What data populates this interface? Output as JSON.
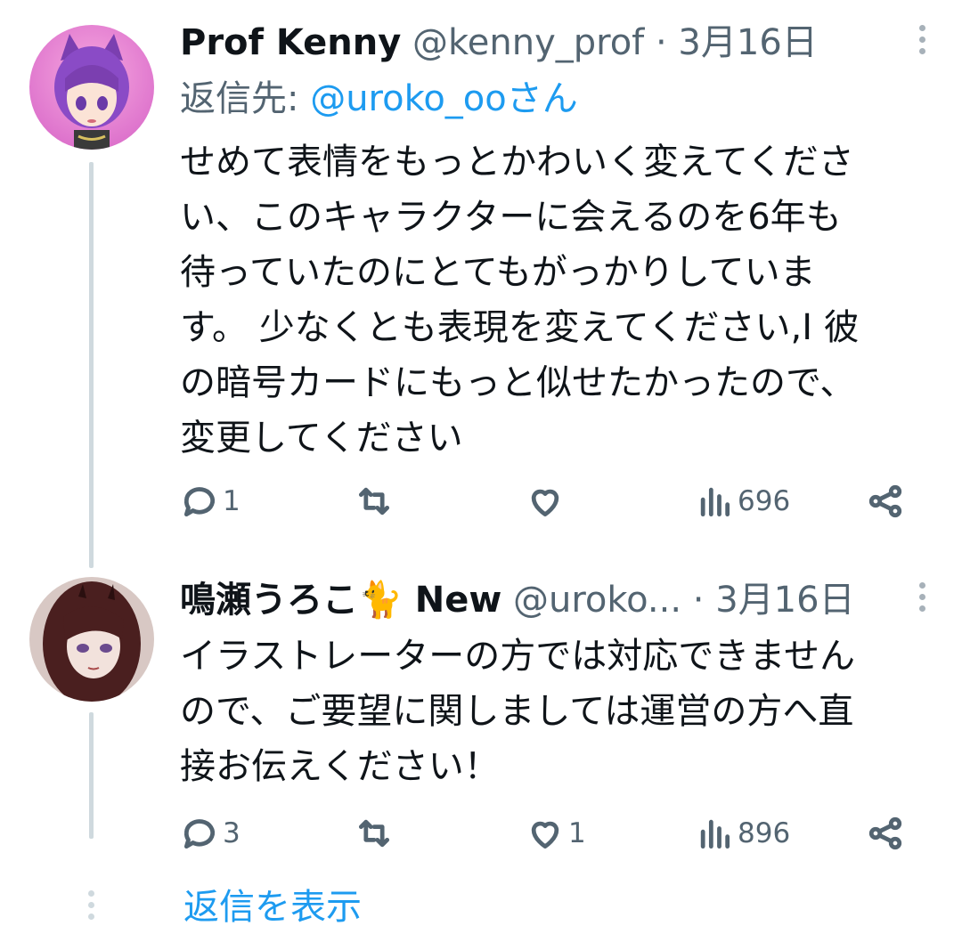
{
  "tweets": [
    {
      "name": "Prof Kenny",
      "handle": "@kenny_prof",
      "date": "3月16日",
      "reply_prefix": "返信先: ",
      "reply_mention": "@uroko_ooさん",
      "lines": [
        "せめて表情をもっとかわいく変えてくださ",
        "い、このキャラクターに会えるのを6年も",
        "待っていたのにとてもがっかりしていま",
        "す。 少なくとも表現を変えてください,I 彼",
        "の暗号カードにもっと似せたかったので、",
        "変更してください"
      ],
      "replies": "1",
      "retweets": "",
      "likes": "",
      "views": "696"
    },
    {
      "name": "鳴瀬うろこ🐈 New",
      "handle": "@uroko...",
      "date": "3月16日",
      "lines": [
        "イラストレーターの方では対応できません",
        "ので、ご要望に関しましては運営の方へ直",
        "接お伝えください！"
      ],
      "replies": "3",
      "retweets": "",
      "likes": "1",
      "views": "896"
    }
  ],
  "show_replies": "返信を表示",
  "icons": [
    "reply-icon",
    "retweet-icon",
    "like-icon",
    "views-icon",
    "share-icon",
    "more-icon"
  ],
  "colors": {
    "link": "#1d9bf0",
    "secondary": "#536471",
    "text": "#0f1419",
    "thread": "#cfd9de"
  }
}
